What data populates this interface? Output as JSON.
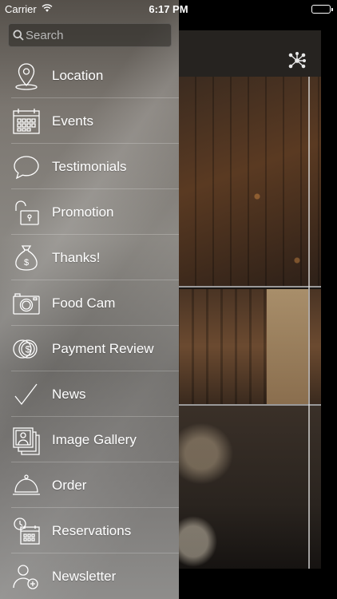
{
  "status_bar": {
    "carrier": "Carrier",
    "time": "6:17 PM"
  },
  "search": {
    "placeholder": "Search",
    "value": ""
  },
  "menu": [
    {
      "label": "Location",
      "icon": "map-pin-icon"
    },
    {
      "label": "Events",
      "icon": "calendar-icon"
    },
    {
      "label": "Testimonials",
      "icon": "speech-bubble-icon"
    },
    {
      "label": "Promotion",
      "icon": "unlocked-padlock-icon"
    },
    {
      "label": "Thanks!",
      "icon": "money-bag-icon"
    },
    {
      "label": "Food Cam",
      "icon": "camera-icon"
    },
    {
      "label": "Payment Review",
      "icon": "coins-icon"
    },
    {
      "label": "News",
      "icon": "checkmark-icon"
    },
    {
      "label": "Image Gallery",
      "icon": "photo-stack-icon"
    },
    {
      "label": "Order",
      "icon": "serving-cloche-icon"
    },
    {
      "label": "Reservations",
      "icon": "calendar-clock-icon"
    },
    {
      "label": "Newsletter",
      "icon": "add-user-icon"
    }
  ],
  "background": {
    "icon": "network-share-icon"
  }
}
